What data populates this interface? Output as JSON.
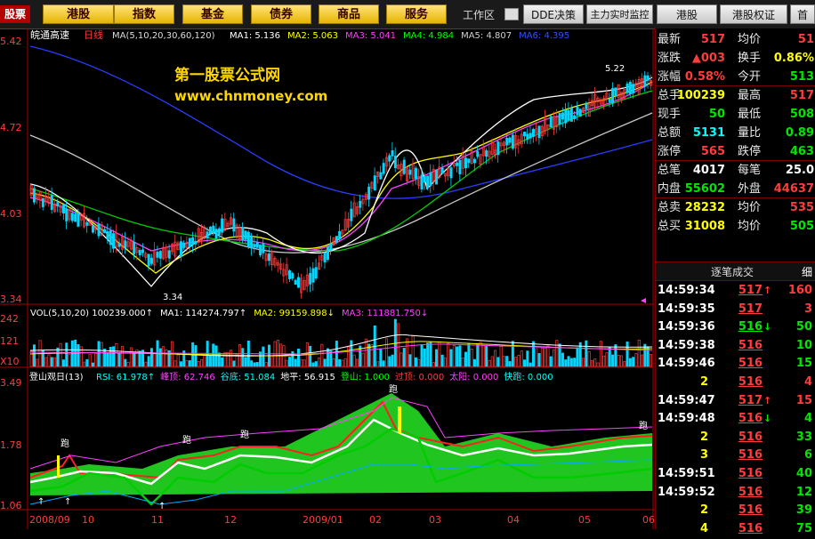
{
  "toolbar": {
    "logo": "股票",
    "buttons": [
      "港股",
      "指数",
      "基金",
      "债券",
      "商品",
      "服务"
    ],
    "workspace_label": "工作区",
    "dde": "DDE决策",
    "monitor": "主力实时监控",
    "hk": "港股",
    "hk_warrant": "港股权证",
    "home": "首"
  },
  "chart": {
    "stock_name": "皖通高速",
    "period": "日线",
    "ma_header": "MA(5,10,20,30,60,120)",
    "ma_values": [
      {
        "label": "MA1: 5.136",
        "arrow": "↑",
        "color": "#ffffff"
      },
      {
        "label": "MA2: 5.063",
        "arrow": "↑",
        "color": "#ffff00"
      },
      {
        "label": "MA3: 5.041",
        "arrow": "↑",
        "color": "#ff40ff"
      },
      {
        "label": "MA4: 4.984",
        "arrow": "↑",
        "color": "#00ff00"
      },
      {
        "label": "MA5: 4.807",
        "arrow": "↑",
        "color": "#d0d0d0"
      },
      {
        "label": "MA6: 4.395",
        "arrow": "↑",
        "color": "#3050ff"
      }
    ],
    "watermark_1": "第一股票公式网",
    "watermark_2": "www.chnmoney.com",
    "price_axis": [
      "5.42",
      "4.72",
      "4.03",
      "3.34"
    ],
    "high_label": "5.22",
    "low_label": "3.34",
    "vol_header": "VOL(5,10,20) 100239.000↑",
    "vol_ma": [
      {
        "label": "MA1: 114274.797↑",
        "color": "#ffffff"
      },
      {
        "label": "MA2: 99159.898↓",
        "color": "#ffff00"
      },
      {
        "label": "MA3: 111881.750↓",
        "color": "#ff40ff"
      }
    ],
    "vol_axis": [
      "242",
      "121",
      "X10"
    ],
    "ind_header": "登山观日(13)",
    "ind_values": [
      {
        "label": "RSI: 61.978↑",
        "color": "#00ffff"
      },
      {
        "label": "峰顶: 62.746",
        "color": "#ff40ff"
      },
      {
        "label": "谷底: 51.084",
        "color": "#00ffff"
      },
      {
        "label": "地平: 56.915",
        "color": "#ffffff"
      },
      {
        "label": "登山: 1.000",
        "color": "#00ff00"
      },
      {
        "label": "过顶: 0.000",
        "color": "#ff3b3b"
      },
      {
        "label": "太阳: 0.000",
        "color": "#ff40ff"
      },
      {
        "label": "快跑: 0.000",
        "color": "#00ffff"
      }
    ],
    "ind_axis": [
      "3.49",
      "1.78",
      "1.06"
    ],
    "run_label": "跑",
    "date_axis": [
      "2008/09",
      "10",
      "11",
      "12",
      "2009/01",
      "02",
      "03",
      "04",
      "05",
      "06"
    ]
  },
  "quote": [
    {
      "l": "最新",
      "lv": "517",
      "lc": "up",
      "r": "均价",
      "rv": "51",
      "rc": "up"
    },
    {
      "l": "涨跌",
      "lv": "▲003",
      "lc": "up",
      "r": "换手",
      "rv": "0.86%",
      "rc": "yl"
    },
    {
      "l": "涨幅",
      "lv": "0.58%",
      "lc": "up",
      "r": "今开",
      "rv": "513",
      "rc": "dn"
    },
    {
      "l": "总手",
      "lv": "100239",
      "lc": "yl",
      "r": "最高",
      "rv": "517",
      "rc": "up"
    },
    {
      "l": "现手",
      "lv": "50",
      "lc": "dn",
      "r": "最低",
      "rv": "508",
      "rc": "dn"
    },
    {
      "l": "总额",
      "lv": "5131",
      "lc": "cy",
      "r": "量比",
      "rv": "0.89",
      "rc": "dn"
    },
    {
      "l": "涨停",
      "lv": "565",
      "lc": "up",
      "r": "跌停",
      "rv": "463",
      "rc": "dn"
    },
    {
      "l": "总笔",
      "lv": "4017",
      "lc": "wh",
      "r": "每笔",
      "rv": "25.0",
      "rc": "wh"
    },
    {
      "l": "内盘",
      "lv": "55602",
      "lc": "dn",
      "r": "外盘",
      "rv": "44637",
      "rc": "up"
    },
    {
      "l": "总卖",
      "lv": "28232",
      "lc": "yl",
      "r": "均价",
      "rv": "535",
      "rc": "up"
    },
    {
      "l": "总买",
      "lv": "31008",
      "lc": "yl",
      "r": "均价",
      "rv": "505",
      "rc": "dn"
    }
  ],
  "ticks_header": {
    "title": "逐笔成交",
    "btn": "细"
  },
  "ticks": [
    {
      "t": "14:59:34",
      "p": "517",
      "pc": "up",
      "a": "↑",
      "ac": "up",
      "v": "160",
      "vc": "up"
    },
    {
      "t": "14:59:35",
      "p": "517",
      "pc": "up",
      "a": "",
      "ac": "",
      "v": "3",
      "vc": "up"
    },
    {
      "t": "14:59:36",
      "p": "516",
      "pc": "dn",
      "a": "↓",
      "ac": "dn",
      "v": "50",
      "vc": "dn"
    },
    {
      "t": "14:59:38",
      "p": "516",
      "pc": "up",
      "a": "",
      "ac": "",
      "v": "10",
      "vc": "dn"
    },
    {
      "t": "14:59:46",
      "p": "516",
      "pc": "up",
      "a": "",
      "ac": "",
      "v": "15",
      "vc": "dn"
    },
    {
      "t": "2",
      "p": "516",
      "pc": "up",
      "a": "",
      "ac": "",
      "v": "4",
      "vc": "up"
    },
    {
      "t": "14:59:47",
      "p": "517",
      "pc": "up",
      "a": "↑",
      "ac": "up",
      "v": "15",
      "vc": "up"
    },
    {
      "t": "14:59:48",
      "p": "516",
      "pc": "up",
      "a": "↓",
      "ac": "dn",
      "v": "4",
      "vc": "dn"
    },
    {
      "t": "2",
      "p": "516",
      "pc": "up",
      "a": "",
      "ac": "",
      "v": "33",
      "vc": "dn"
    },
    {
      "t": "3",
      "p": "516",
      "pc": "up",
      "a": "",
      "ac": "",
      "v": "6",
      "vc": "dn"
    },
    {
      "t": "14:59:51",
      "p": "516",
      "pc": "up",
      "a": "",
      "ac": "",
      "v": "40",
      "vc": "dn"
    },
    {
      "t": "14:59:52",
      "p": "516",
      "pc": "up",
      "a": "",
      "ac": "",
      "v": "12",
      "vc": "dn"
    },
    {
      "t": "2",
      "p": "516",
      "pc": "up",
      "a": "",
      "ac": "",
      "v": "39",
      "vc": "dn"
    },
    {
      "t": "4",
      "p": "516",
      "pc": "up",
      "a": "",
      "ac": "",
      "v": "75",
      "vc": "dn"
    }
  ]
}
